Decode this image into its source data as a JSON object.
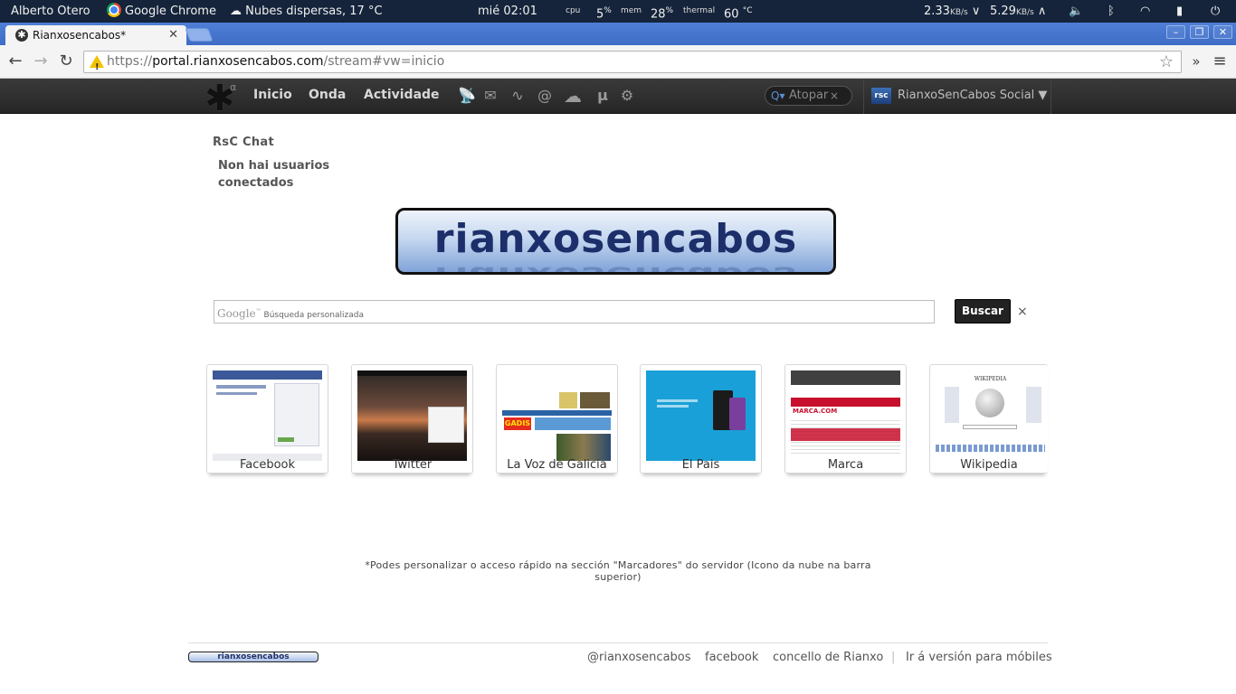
{
  "system_bar": {
    "user": "Alberto Otero",
    "active_app": "Google Chrome",
    "weather": "Nubes dispersas, 17 °C",
    "clock": "mié 02:01",
    "cpu_label": "cpu",
    "cpu_value": "5",
    "mem_label": "mem",
    "mem_value": "28",
    "percent": "%",
    "thermal_label": "thermal",
    "thermal_value": "60",
    "thermal_unit": "°C",
    "download": "2.33",
    "upload": "5.29",
    "rate_unit": "KB/s",
    "icons": [
      "weather-icon",
      "volume-icon",
      "bluetooth-icon",
      "wifi-icon",
      "battery-icon",
      "power-icon"
    ]
  },
  "browser": {
    "tab_title": "Rianxosencabos*",
    "url_scheme": "https://",
    "url_host": "portal.rianxosencabos.com",
    "url_path": "/stream#vw=inicio"
  },
  "site_nav": {
    "logo_alpha": "α",
    "links": [
      "Inicio",
      "Onda",
      "Actividade"
    ],
    "icons": [
      "satellite-icon",
      "mail-icon",
      "pulse-icon",
      "at-icon",
      "cloud-icon",
      "mu-icon",
      "gear-icon"
    ],
    "search_placeholder": "Atopar",
    "profile_avatar": "rsc",
    "profile_name": "RianxoSenCabos Social ▼"
  },
  "chat": {
    "title": "RsC Chat",
    "empty_message": "Non hai usuarios conectados"
  },
  "banner": {
    "text": "rianxosencabos"
  },
  "search": {
    "google_logo": "Google",
    "tm": "™",
    "placeholder": "Búsqueda personalizada",
    "button": "Buscar",
    "clear": "×"
  },
  "speed_dial": [
    {
      "label": "Facebook"
    },
    {
      "label": "Twitter"
    },
    {
      "label": "La Voz de Galicia",
      "thumb_brand": "GADIS"
    },
    {
      "label": "El Pais"
    },
    {
      "label": "Marca",
      "thumb_brand": "MARCA.COM"
    },
    {
      "label": "Wikipedia",
      "thumb_brand": "WIKIPEDIA"
    }
  ],
  "note": "*Podes personalizar o acceso rápido na sección \"Marcadores\" do servidor (Icono da nube na barra superior)",
  "footer": {
    "logo_text": "rianxosencabos",
    "links": [
      "@rianxosencabos",
      "facebook",
      "concello de Rianxo",
      "Ir á versión para móbiles"
    ],
    "separator": "|"
  }
}
